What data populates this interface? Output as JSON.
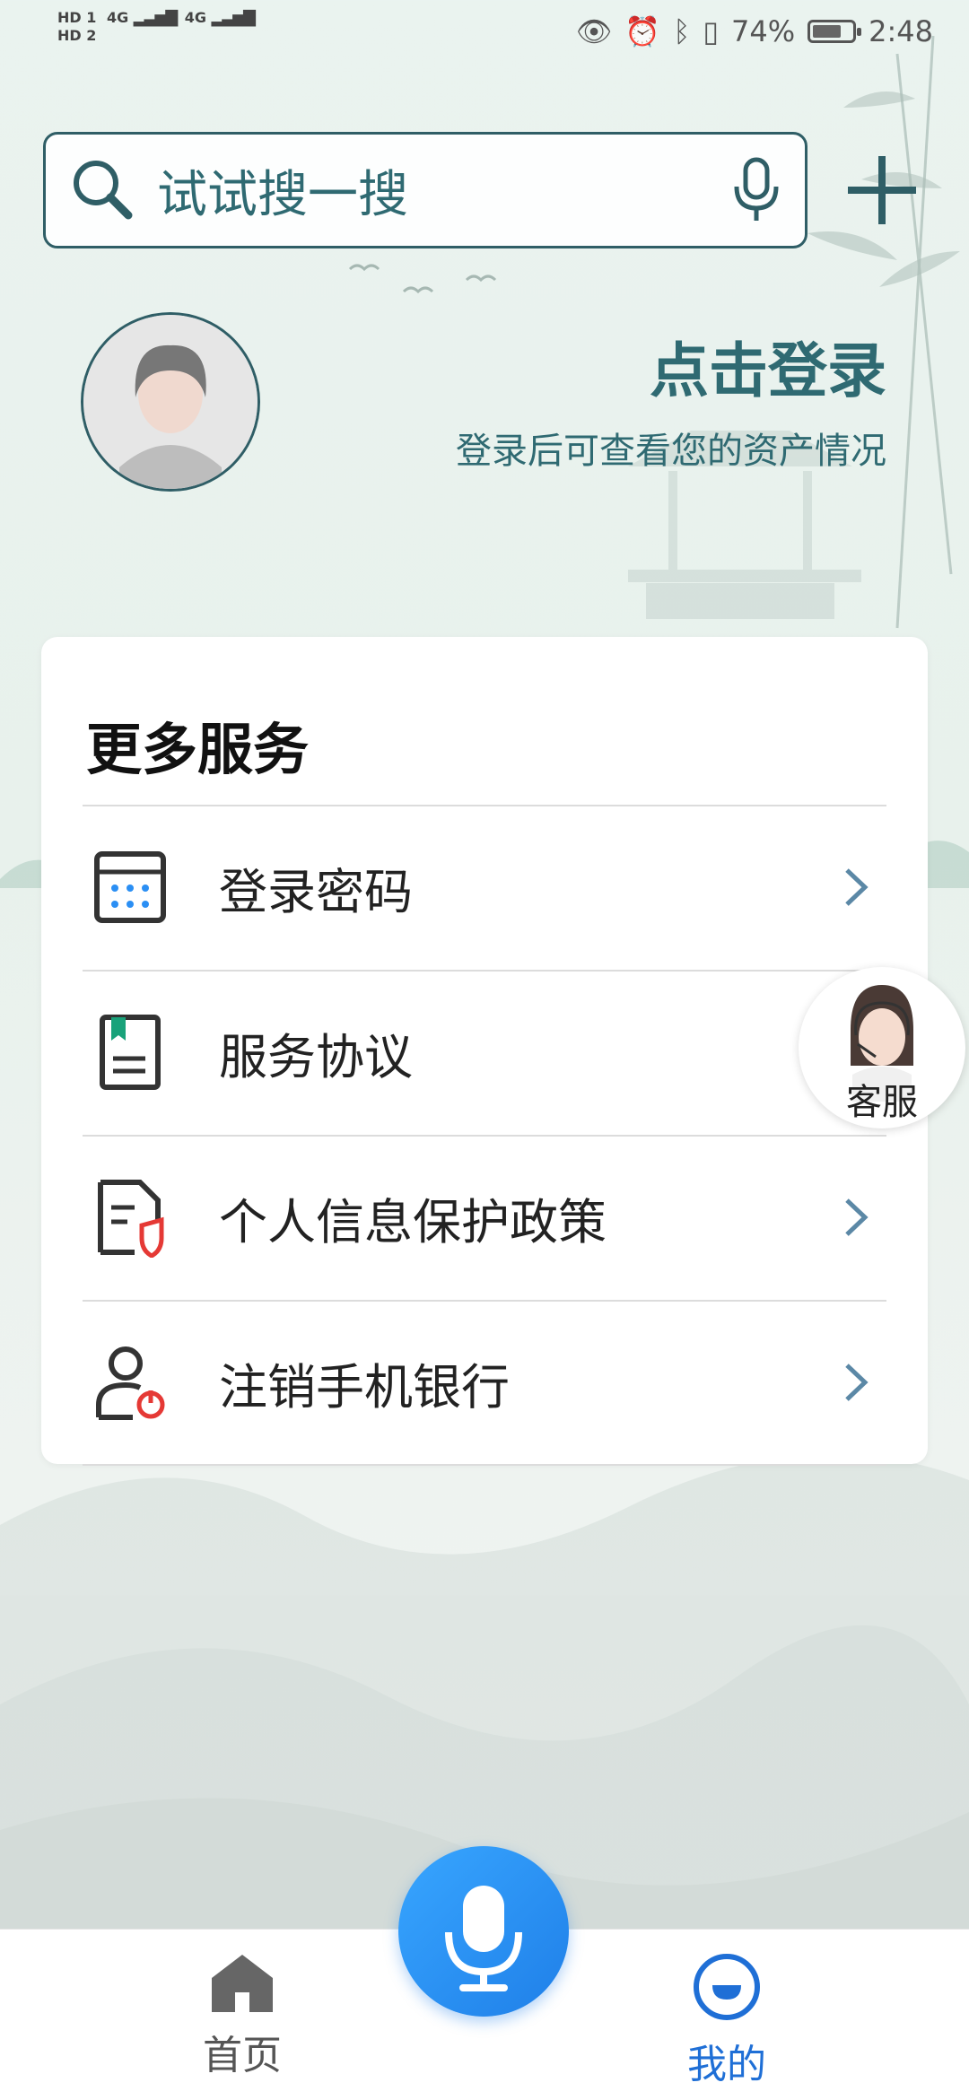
{
  "status_bar": {
    "sim1": "HD 1",
    "sim2": "HD 2",
    "net1": "4G",
    "net2": "4G",
    "battery": "74%",
    "battery_level": 0.74,
    "time": "2:48",
    "icons": [
      "eye-icon",
      "alarm-icon",
      "bluetooth-icon",
      "vibrate-icon",
      "battery-icon"
    ]
  },
  "search": {
    "placeholder": "试试搜一搜",
    "left_icon": "search-icon",
    "right_icon": "microphone-icon"
  },
  "header": {
    "add_icon": "plus-icon"
  },
  "profile": {
    "login_title": "点击登录",
    "login_subtitle": "登录后可查看您的资产情况"
  },
  "services": {
    "title": "更多服务",
    "items": [
      {
        "label": "登录密码",
        "icon": "keypad-icon"
      },
      {
        "label": "服务协议",
        "icon": "agreement-document-icon"
      },
      {
        "label": "个人信息保护政策",
        "icon": "privacy-shield-document-icon"
      },
      {
        "label": "注销手机银行",
        "icon": "user-power-off-icon"
      }
    ]
  },
  "customer_service": {
    "label": "客服"
  },
  "bottom_nav": {
    "home_label": "首页",
    "me_label": "我的",
    "active": "我的"
  },
  "colors": {
    "primary_teal": "#2f6a72",
    "nav_active": "#1f6fd6",
    "fab_blue": "#2b8ff4",
    "accent_red": "#e53935",
    "accent_green": "#19a27a"
  }
}
